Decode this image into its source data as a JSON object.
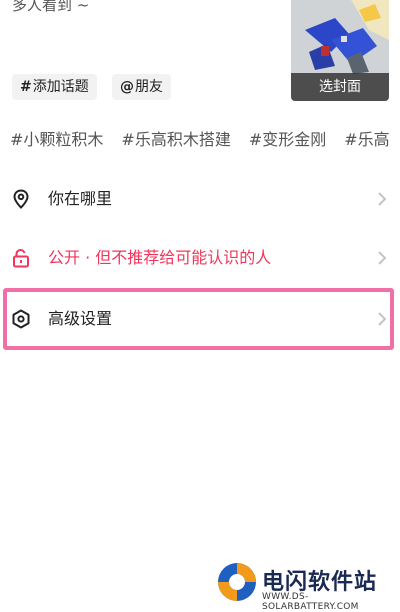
{
  "post": {
    "description": "多人看到 ~"
  },
  "cover": {
    "button_label": "选封面"
  },
  "chips": [
    {
      "symbol": "#",
      "label": "添加话题"
    },
    {
      "symbol": "@",
      "label": "朋友"
    }
  ],
  "suggested_tags": [
    "#小颗粒积木",
    "#乐高积木搭建",
    "#变形金刚",
    "#乐高"
  ],
  "settings": {
    "location": {
      "label": "你在哪里",
      "icon": "location-pin-icon"
    },
    "privacy": {
      "label": "公开 · 但不推荐给可能认识的人",
      "icon": "unlock-icon",
      "color": "#f0365a"
    },
    "advanced": {
      "label": "高级设置",
      "icon": "hexagon-settings-icon"
    }
  },
  "highlight_color": "#ef6fa6",
  "watermark": {
    "title": "电闪软件站",
    "url": "WWW.DS-SOLARBATTERY.COM"
  }
}
